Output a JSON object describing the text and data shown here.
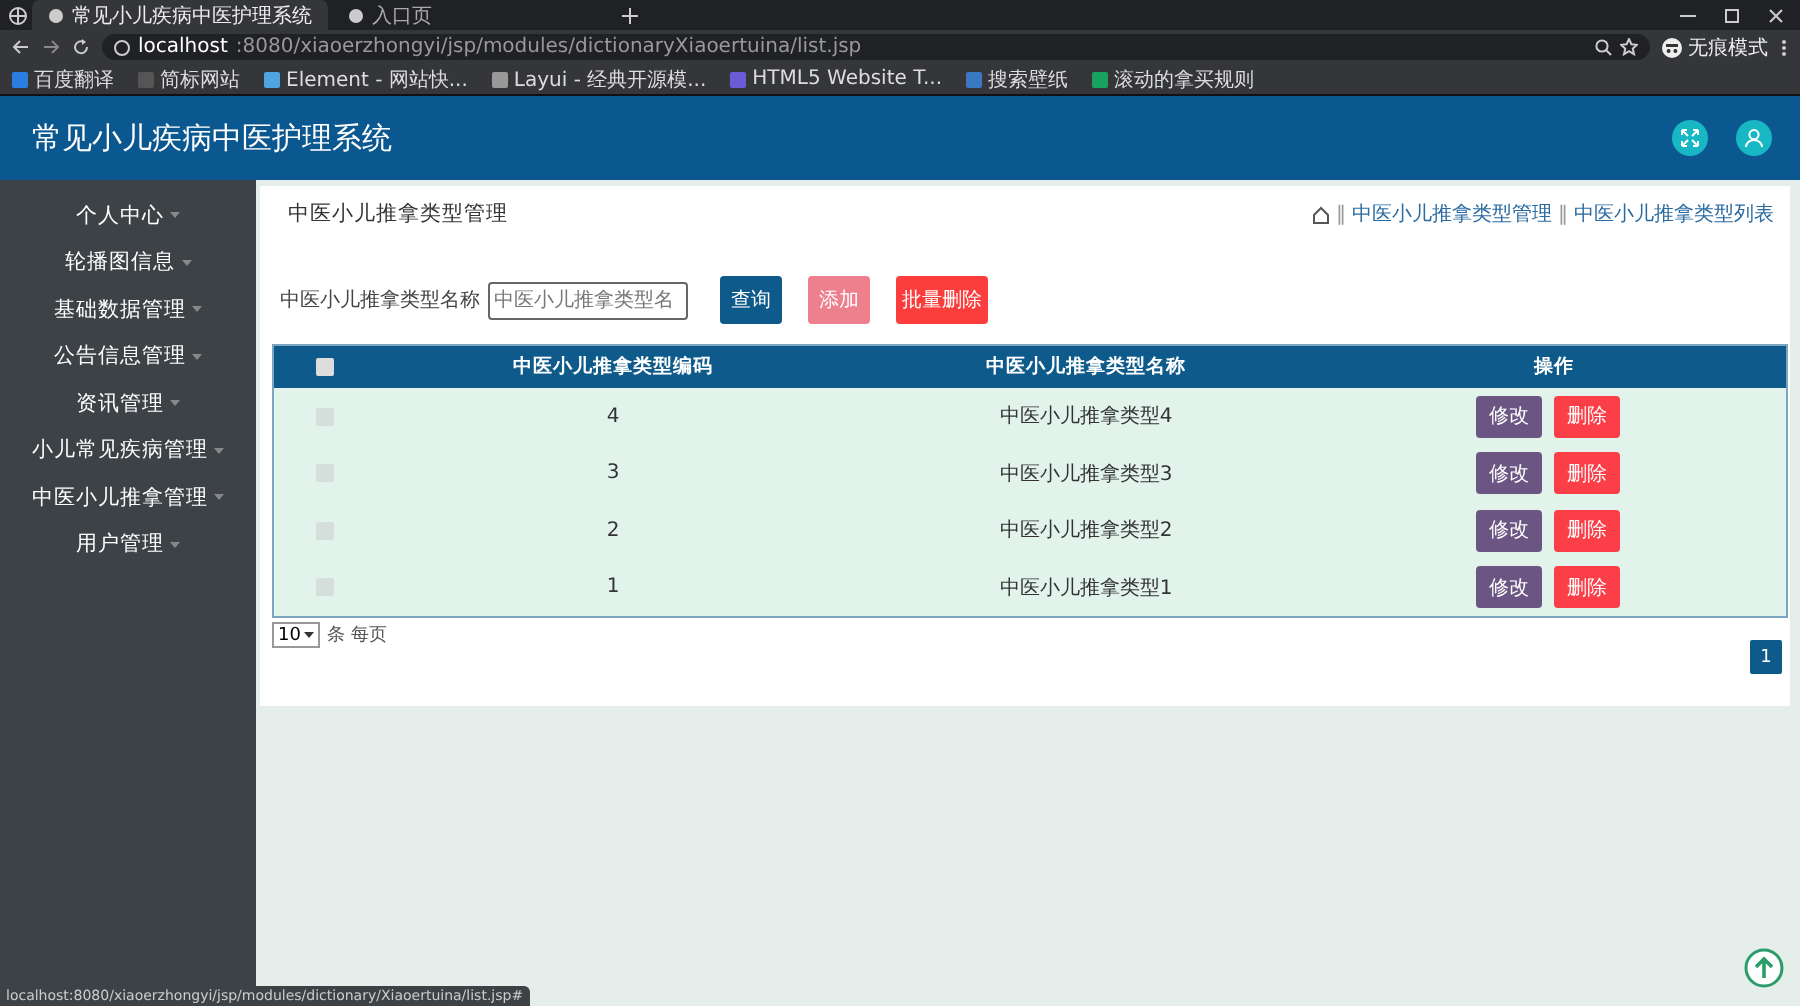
{
  "browser": {
    "tabs": [
      {
        "label": "常见小儿疾病中医护理系统",
        "selected": true
      },
      {
        "label": "入口页",
        "selected": false
      }
    ],
    "url_host": "localhost",
    "url_path": ":8080/xiaoerzhongyi/jsp/modules/dictionaryXiaoertuina/list.jsp",
    "profile": "无痕模式",
    "bookmarks": [
      "百度翻译",
      "简标网站",
      "Element - 网站快...",
      "Layui - 经典开源模...",
      "HTML5 Website T...",
      "搜索壁纸",
      "滚动的拿买规则"
    ]
  },
  "app": {
    "title": "常见小儿疾病中医护理系统"
  },
  "sidebar": {
    "items": [
      "个人中心",
      "轮播图信息",
      "基础数据管理",
      "公告信息管理",
      "资讯管理",
      "小儿常见疾病管理",
      "中医小儿推拿管理",
      "用户管理"
    ]
  },
  "page": {
    "title": "中医小儿推拿类型管理",
    "breadcrumb_separator": "‖",
    "breadcrumb": [
      "中医小儿推拿类型管理",
      "中医小儿推拿类型列表"
    ]
  },
  "search": {
    "label": "中医小儿推拿类型名称",
    "placeholder": "中医小儿推拿类型名"
  },
  "buttons": [
    {
      "label": "查询",
      "kind": "query"
    },
    {
      "label": "添加",
      "kind": "add"
    },
    {
      "label": "批量删除",
      "kind": "delete"
    }
  ],
  "table": {
    "select_all": false,
    "columns": [
      "中医小儿推拿类型编码",
      "中医小儿推拿类型名称",
      "操作"
    ],
    "rows": [
      {
        "checked": false,
        "code": "4",
        "name": "中医小儿推拿类型4",
        "actions": [
          "修改",
          "删除"
        ]
      },
      {
        "checked": false,
        "code": "3",
        "name": "中医小儿推拿类型3",
        "actions": [
          "修改",
          "删除"
        ]
      },
      {
        "checked": false,
        "code": "2",
        "name": "中医小儿推拿类型2",
        "actions": [
          "修改",
          "删除"
        ]
      },
      {
        "checked": false,
        "code": "1",
        "name": "中医小儿推拿类型1",
        "actions": [
          "修改",
          "删除"
        ]
      }
    ]
  },
  "page_size": {
    "value": "10",
    "label": "条 每页"
  },
  "pagination": [
    {
      "label": "1",
      "selected": true
    }
  ],
  "status_url": "localhost:8080/xiaoerzhongyi/jsp/modules/dictionary/Xiaoertuina/list.jsp#"
}
